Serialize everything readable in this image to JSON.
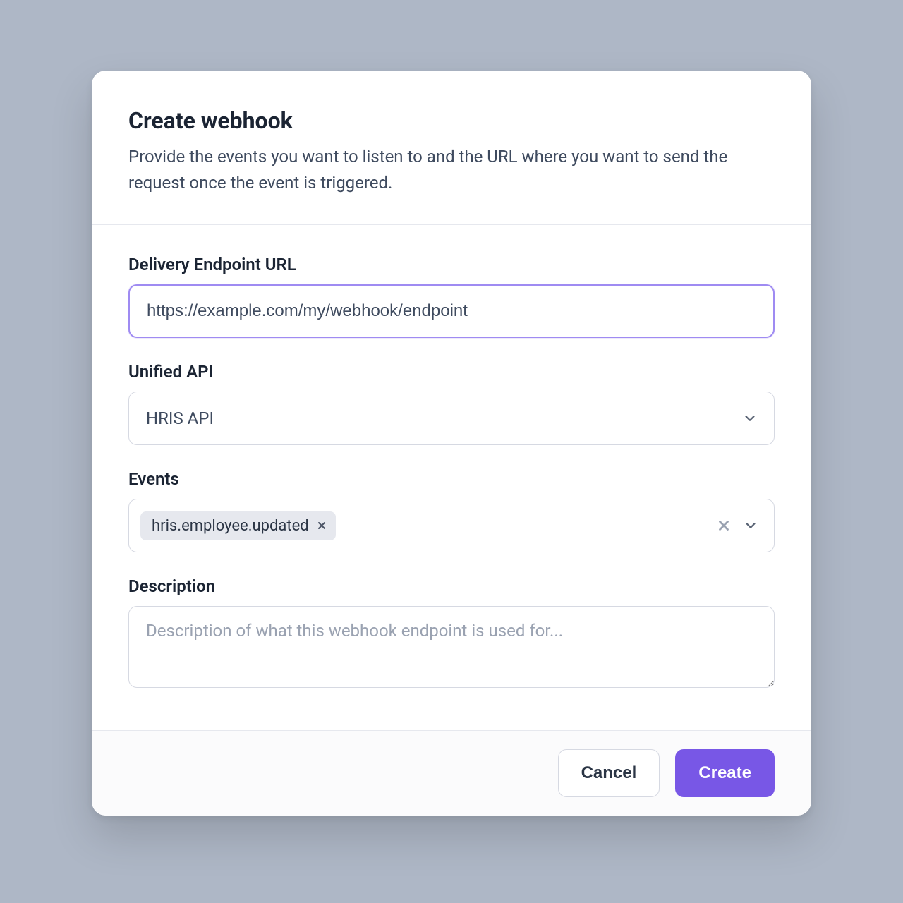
{
  "modal": {
    "title": "Create webhook",
    "subtitle": "Provide the events you want to listen to and the URL where you want to send the request once the event is triggered."
  },
  "fields": {
    "endpoint": {
      "label": "Delivery Endpoint URL",
      "value": "https://example.com/my/webhook/endpoint"
    },
    "unified_api": {
      "label": "Unified API",
      "selected": "HRIS API"
    },
    "events": {
      "label": "Events",
      "tags": [
        "hris.employee.updated"
      ]
    },
    "description": {
      "label": "Description",
      "placeholder": "Description of what this webhook endpoint is used for...",
      "value": ""
    }
  },
  "footer": {
    "cancel": "Cancel",
    "create": "Create"
  },
  "colors": {
    "accent": "#7857e6",
    "focus_ring": "#9f8bf2",
    "text_primary": "#1b2433",
    "text_secondary": "#3f4b5f",
    "border": "#d6d9e2",
    "tag_bg": "#e6e8ee",
    "page_bg": "#aeb7c6"
  }
}
